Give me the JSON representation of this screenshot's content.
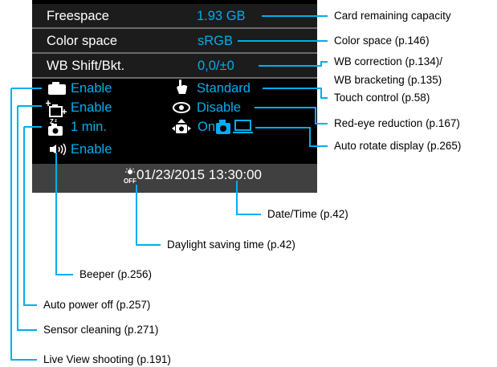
{
  "screen": {
    "rows": [
      {
        "label": "Freespace",
        "value": "1.93 GB"
      },
      {
        "label": "Color space",
        "value": "sRGB"
      },
      {
        "label": "WB Shift/Bkt.",
        "value": "0,0/±0"
      }
    ],
    "live_view_shooting": "Enable",
    "touch_control": "Standard",
    "sensor_cleaning": "Enable",
    "red_eye_reduction": "Disable",
    "auto_power_off": "1 min.",
    "auto_rotate": "On",
    "beeper": "Enable",
    "datetime": "01/23/2015 13:30:00"
  },
  "callouts": {
    "card_remaining": "Card remaining capacity",
    "color_space": "Color space (p.146)",
    "wb_correction": "WB correction (p.134)/",
    "wb_bracketing": "WB bracketing (p.135)",
    "touch_control": "Touch control (p.58)",
    "red_eye": "Red-eye reduction (p.167)",
    "auto_rotate": "Auto rotate display (p.265)",
    "date_time": "Date/Time (p.42)",
    "daylight_saving": "Daylight saving time (p.42)",
    "beeper": "Beeper (p.256)",
    "auto_power_off": "Auto power off (p.257)",
    "sensor_cleaning": "Sensor cleaning (p.271)",
    "live_view": "Live View shooting (p.191)"
  },
  "colors": {
    "screen_bg": "#000000",
    "row_bg": "#1c1c1c",
    "footer_bg": "#404040",
    "value_blue": "#00aeef",
    "leader_blue": "#00aeef",
    "text": "#ffffff"
  }
}
